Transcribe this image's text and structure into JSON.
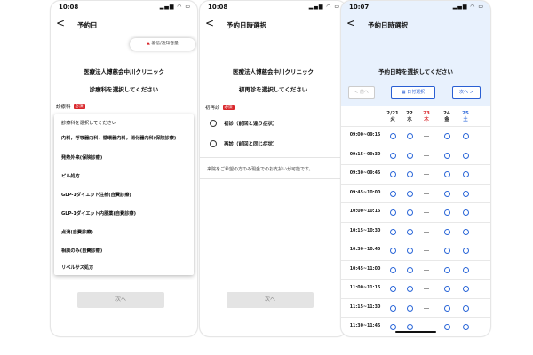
{
  "screen1": {
    "time": "10:08",
    "title": "予約日",
    "clinic": "医療法人博慈会中川クリニック",
    "subtitle": "診療科を選択してください",
    "field_label": "診療科",
    "required": "必須",
    "notification": "着信/通知音量",
    "options": [
      "診療科を選択してください",
      "内科，呼吸器内科，循環器内科，消化器内科(保険診療)",
      "発熱外来(保険診療)",
      "ピル処方",
      "GLP-1ダイエット注射(自費診療)",
      "GLP-1ダイエット内服薬(自費診療)",
      "点滴(自費診療)",
      "相談のみ(自費診療)",
      "リベルサス処方"
    ],
    "next": "次へ"
  },
  "screen2": {
    "time": "10:08",
    "title": "予約日時選択",
    "clinic": "医療法人博慈会中川クリニック",
    "subtitle": "初再診を選択してください",
    "field_label": "初再診",
    "required": "必須",
    "radios": [
      "初診（前回と違う症状）",
      "再診（前回と同じ症状）"
    ],
    "note": "来院をご希望の方のみ現金でのお支払いが可能です。",
    "next": "次へ"
  },
  "screen3": {
    "time": "10:07",
    "title": "予約日時選択",
    "subtitle": "予約日時を選択してください",
    "prev": "< 前へ",
    "date_select": "日付選択",
    "next": "次へ >",
    "days": [
      {
        "date": "2/21",
        "wd": "火",
        "color": "#111111"
      },
      {
        "date": "22",
        "wd": "水",
        "color": "#111111"
      },
      {
        "date": "23",
        "wd": "木",
        "color": "#d9262b"
      },
      {
        "date": "24",
        "wd": "金",
        "color": "#111111"
      },
      {
        "date": "25",
        "wd": "土",
        "color": "#2a66d8"
      }
    ],
    "times": [
      "09:00~09:15",
      "09:15~09:30",
      "09:30~09:45",
      "09:45~10:00",
      "10:00~10:15",
      "10:15~10:30",
      "10:30~10:45",
      "10:45~11:00",
      "11:00~11:15",
      "11:15~11:30",
      "11:30~11:45"
    ],
    "slot_pattern": [
      "o",
      "o",
      "-",
      "o",
      "o"
    ]
  }
}
